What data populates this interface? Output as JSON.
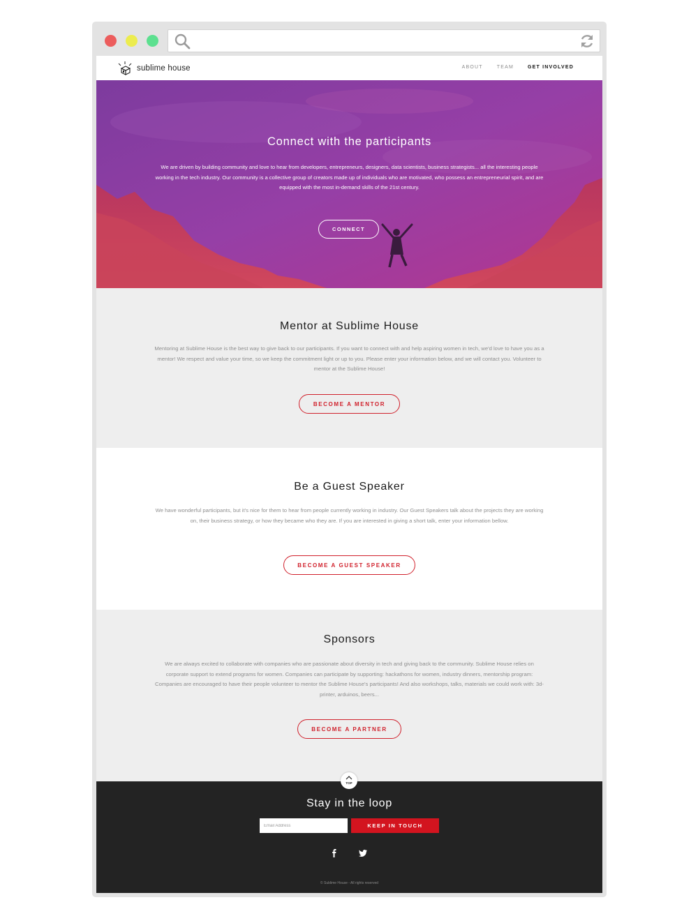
{
  "colors": {
    "accent_red": "#d0202b",
    "footer_bg": "#232323",
    "hero_purple": "#8a3ea0",
    "page_bg": "#eeeeee"
  },
  "browser": {
    "icons": [
      "search-icon",
      "reload-icon"
    ]
  },
  "nav": {
    "logo_text": "sublime house",
    "links": [
      "ABOUT",
      "TEAM",
      "GET INVOLVED"
    ],
    "active": "GET INVOLVED"
  },
  "hero": {
    "title": "Connect with the participants",
    "text": "We are driven by building community and love to hear from developers, entrepreneurs, designers, data scientists, business strategists... all the interesting people working in the tech industry. Our community is a collective group of creators made up of individuals who are motivated, who possess an entrepreneurial spirit, and are equipped with the most in-demand skills of the 21st century.",
    "button": "CONNECT"
  },
  "sections": {
    "mentor": {
      "title": "Mentor at Sublime House",
      "text": "Mentoring at Sublime House is the best way to give back to our participants. If you want to connect with and help aspiring women in tech, we'd love to have you as a mentor! We respect and value your time, so we keep the commitment light or up to you. Please enter your information below, and we will contact you. Volunteer to mentor at the Sublime House!",
      "button": "BECOME A MENTOR"
    },
    "speaker": {
      "title": "Be a Guest Speaker",
      "text": "We have wonderful participants, but it's nice for them to hear from people currently working in industry. Our Guest Speakers talk about the projects they are working on, their business strategy, or how they became who they are. If you are interested in giving a short talk, enter your information bellow.",
      "button": "BECOME A GUEST SPEAKER"
    },
    "sponsor": {
      "title": "Sponsors",
      "text": "We are always excited to collaborate with companies who are passionate about diversity in tech and giving back to the community. Sublime House relies on corporate support to extend programs for women. Companies can participate by supporting: hackathons for women, industry dinners, mentorship program: Companies are encouraged to have their people volunteer to mentor the Sublime House's participants! And also workshops, talks, materials we could work with: 3d-printer, arduinos, beers...",
      "button": "BECOME A PARTNER"
    }
  },
  "footer": {
    "top_label": "TOP",
    "title": "Stay in the loop",
    "email_placeholder": "Email Address",
    "email_value": "",
    "button": "KEEP IN TOUCH",
    "social_icons": [
      "facebook-icon",
      "twitter-icon"
    ],
    "copyright": "© Sublime House - All rights reserved"
  }
}
